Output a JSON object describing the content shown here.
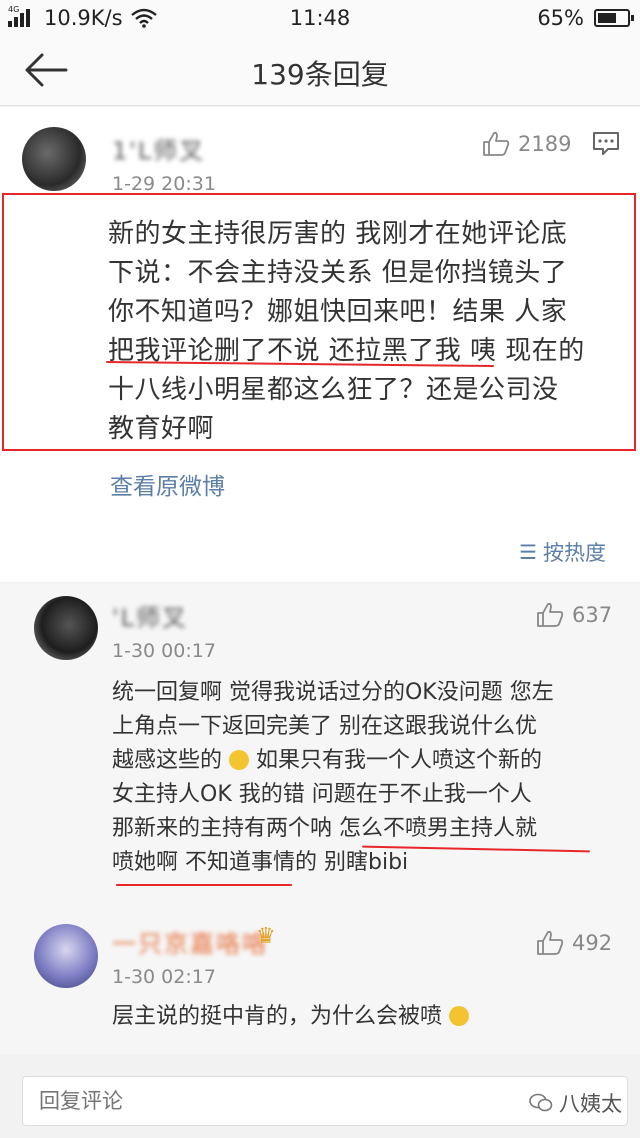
{
  "status": {
    "network": "4G",
    "speed": "10.9K/s",
    "time": "11:48",
    "battery": "65%"
  },
  "nav": {
    "title": "139条回复"
  },
  "post": {
    "username": "1'L师叉",
    "timestamp": "1-29 20:31",
    "likes": "2189",
    "text_lines": [
      "新的女主持很厉害的 我刚才在她评论底",
      "下说：不会主持没关系 但是你挡镜头了",
      "你不知道吗？娜姐快回来吧！结果 人家",
      "把我评论删了不说 还拉黑了我 咦 现在的",
      "十八线小明星都这么狂了？还是公司没",
      "教育好啊"
    ],
    "view_original": "查看原微博",
    "sort_label": "按热度"
  },
  "comments": [
    {
      "username": "'L师叉",
      "timestamp": "1-30 00:17",
      "likes": "637",
      "text_lines": [
        "统一回复啊 觉得我说话过分的OK没问题 您左",
        "上角点一下返回完美了 别在这跟我说什么优",
        "越感这些的",
        "女主持人OK 我的错 问题在于不止我一个人",
        "那新来的主持有两个呐 怎么不喷男主持人就",
        "喷她啊 不知道事情的 别瞎bibi"
      ],
      "line3_tail": " 如果只有我一个人喷这个新的"
    },
    {
      "username": "一只京嘉咯咯",
      "timestamp": "1-30 02:17",
      "likes": "492",
      "text": "层主说的挺中肯的，为什么会被喷"
    }
  ],
  "reply_bar": {
    "placeholder": "回复评论"
  },
  "watermark": "八姨太",
  "colors": {
    "highlight": "#e8262a",
    "link": "#5b7fa6"
  },
  "icons": [
    "back-arrow-icon",
    "thumbs-up-icon",
    "reply-icon",
    "sort-icon",
    "wechat-icon",
    "crown-icon"
  ]
}
